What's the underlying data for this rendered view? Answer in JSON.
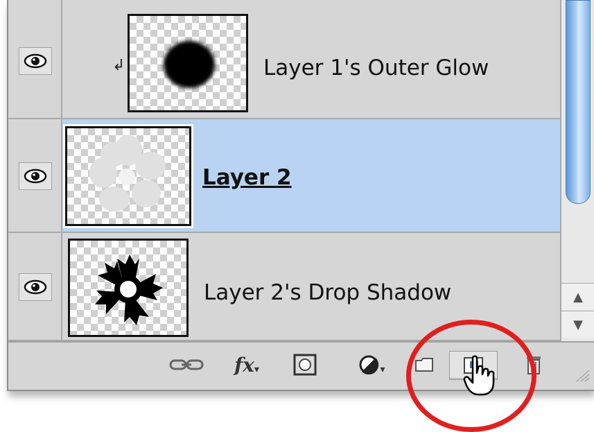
{
  "layers": [
    {
      "name": "Layer 1's Outer Glow",
      "selected": false,
      "clipped": true,
      "clip_icon": "clipping-arrow-icon",
      "thumbnail": "black-blurred-circle"
    },
    {
      "name": "Layer 2",
      "selected": true,
      "clipped": false,
      "thumbnail": "white-flower"
    },
    {
      "name": "Layer 2's Drop Shadow",
      "selected": false,
      "clipped": false,
      "thumbnail": "black-flower"
    }
  ],
  "toolbar": {
    "buttons": [
      {
        "icon": "link-layers-icon"
      },
      {
        "icon": "fx-icon",
        "label": "fx"
      },
      {
        "icon": "layer-mask-icon"
      },
      {
        "icon": "adjustment-layer-icon"
      },
      {
        "icon": "group-folder-icon"
      },
      {
        "icon": "new-layer-icon",
        "pressed": true
      },
      {
        "icon": "trash-icon"
      }
    ]
  },
  "colors": {
    "panel_bg": "#d6d6d6",
    "selected_row": "#b9d3f2",
    "annotation": "#e01f1f",
    "scroll_thumb": "#7db0e6"
  }
}
